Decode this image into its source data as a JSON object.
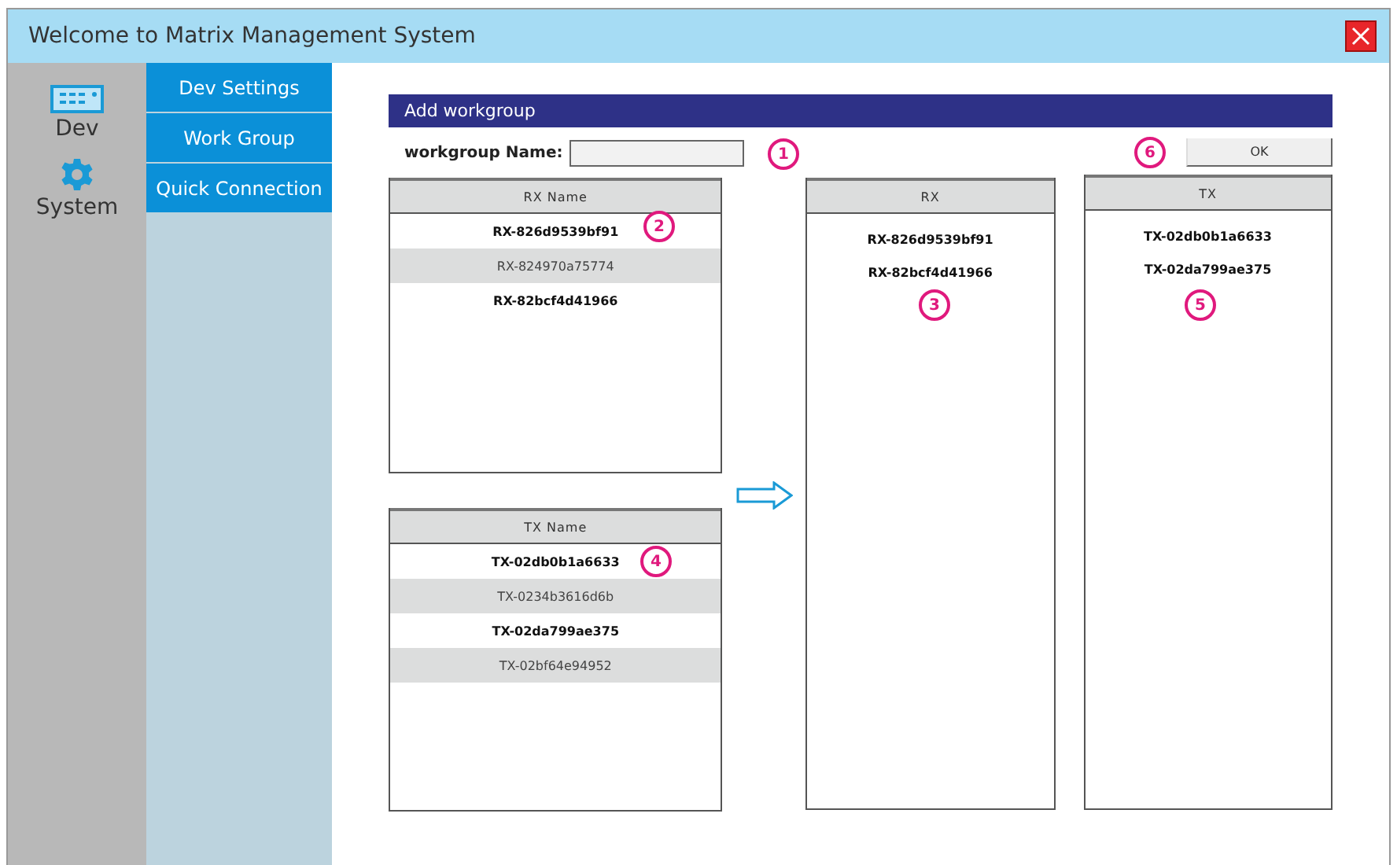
{
  "window": {
    "title": "Welcome to Matrix Management System"
  },
  "nav": [
    {
      "kind": "device",
      "label": "Dev"
    },
    {
      "kind": "gear",
      "label": "System"
    }
  ],
  "menu": [
    {
      "label": "Dev Settings"
    },
    {
      "label": "Work Group"
    },
    {
      "label": "Quick Connection"
    }
  ],
  "dialog": {
    "title": "Add workgroup",
    "name_label": "workgroup Name:",
    "ok": "OK",
    "rx_list": {
      "header": "RX Name",
      "items": [
        {
          "label": "RX-826d9539bf91",
          "selected": true
        },
        {
          "label": "RX-824970a75774",
          "selected": false
        },
        {
          "label": "RX-82bcf4d41966",
          "selected": true
        }
      ]
    },
    "tx_list": {
      "header": "TX Name",
      "items": [
        {
          "label": "TX-02db0b1a6633",
          "selected": true
        },
        {
          "label": "TX-0234b3616d6b",
          "selected": false
        },
        {
          "label": "TX-02da799ae375",
          "selected": true
        },
        {
          "label": "TX-02bf64e94952",
          "selected": false
        }
      ]
    },
    "rx_group": {
      "header": "RX",
      "items": [
        "RX-826d9539bf91",
        "RX-82bcf4d41966"
      ]
    },
    "tx_group": {
      "header": "TX",
      "items": [
        "TX-02db0b1a6633",
        "TX-02da799ae375"
      ]
    },
    "callouts": [
      "1",
      "2",
      "3",
      "4",
      "5",
      "6"
    ]
  }
}
